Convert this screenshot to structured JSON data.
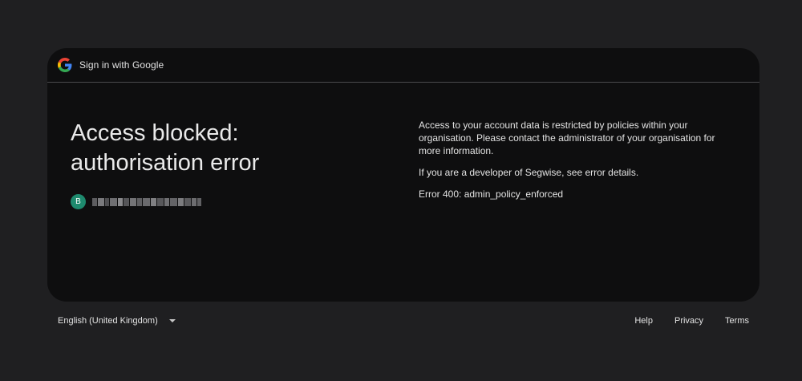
{
  "header": {
    "title": "Sign in with Google",
    "logo_icon": "google-g-icon"
  },
  "main": {
    "headline_line1": "Access blocked:",
    "headline_line2": "authorisation error",
    "account": {
      "avatar_letter": "B",
      "avatar_color": "#1e8a6e"
    },
    "message": "Access to your account data is restricted by policies within your organisation. Please contact the administrator of your organisation for more information.",
    "developer_prefix": "If you are a developer of Segwise, see ",
    "error_details_link": "error details",
    "developer_suffix": ".",
    "error_code": "Error 400: admin_policy_enforced"
  },
  "footer": {
    "language": "English (United Kingdom)",
    "links": {
      "help": "Help",
      "privacy": "Privacy",
      "terms": "Terms"
    }
  },
  "colors": {
    "background": "#1f1f21",
    "card": "#0e0e0f",
    "text": "#e3e3e3"
  }
}
